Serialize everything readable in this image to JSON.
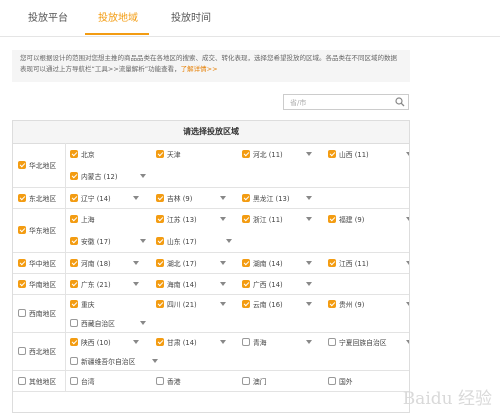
{
  "tabs": [
    "投放平台",
    "投放地域",
    "投放时间"
  ],
  "notice": {
    "text": "您可以根据设计的范围对您想主推的商品品类在各地区的搜索、成交、转化表现，选择您希望投放的区域。各品类在不同区域的数据表现可以通过上方导航栏“工具>>流量解析”功能查看，",
    "link": "了解详情>>"
  },
  "search": {
    "placeholder": "省/市"
  },
  "grid": {
    "header": "请选择投放区域"
  },
  "regions": [
    {
      "name": "华北地区",
      "checked": true,
      "provinces": [
        [
          "北京",
          true,
          false
        ],
        [
          "天津",
          true,
          false
        ],
        [
          "河北 (11)",
          true,
          true
        ],
        [
          "山西 (11)",
          true,
          true
        ],
        [
          "内蒙古 (12)",
          true,
          true
        ]
      ]
    },
    {
      "name": "东北地区",
      "checked": true,
      "provinces": [
        [
          "辽宁 (14)",
          true,
          true
        ],
        [
          "吉林 (9)",
          true,
          true
        ],
        [
          "黑龙江 (13)",
          true,
          true
        ]
      ]
    },
    {
      "name": "华东地区",
      "checked": true,
      "provinces": [
        [
          "上海",
          true,
          false
        ],
        [
          "江苏 (13)",
          true,
          true
        ],
        [
          "浙江 (11)",
          true,
          true
        ],
        [
          "福建 (9)",
          true,
          true
        ],
        [
          "安徽 (17)",
          true,
          true
        ],
        [
          "山东 (17)",
          true,
          true
        ]
      ]
    },
    {
      "name": "华中地区",
      "checked": true,
      "provinces": [
        [
          "河南 (18)",
          true,
          true
        ],
        [
          "湖北 (17)",
          true,
          true
        ],
        [
          "湖南 (14)",
          true,
          true
        ],
        [
          "江西 (11)",
          true,
          true
        ]
      ]
    },
    {
      "name": "华南地区",
      "checked": true,
      "provinces": [
        [
          "广东 (21)",
          true,
          true
        ],
        [
          "海南 (14)",
          true,
          true
        ],
        [
          "广西 (14)",
          true,
          true
        ]
      ]
    },
    {
      "name": "西南地区",
      "checked": false,
      "provinces": [
        [
          "重庆",
          true,
          false
        ],
        [
          "四川 (21)",
          true,
          true
        ],
        [
          "云南 (16)",
          true,
          true
        ],
        [
          "贵州 (9)",
          true,
          true
        ],
        [
          "西藏自治区",
          false,
          true
        ]
      ]
    },
    {
      "name": "西北地区",
      "checked": false,
      "provinces": [
        [
          "陕西 (10)",
          true,
          true
        ],
        [
          "甘肃 (14)",
          true,
          true
        ],
        [
          "青海",
          false,
          true
        ],
        [
          "宁夏回族自治区",
          false,
          true
        ],
        [
          "新疆维吾尔自治区",
          false,
          true
        ]
      ]
    },
    {
      "name": "其他地区",
      "checked": false,
      "provinces": [
        [
          "台湾",
          false,
          false
        ],
        [
          "香港",
          false,
          false
        ],
        [
          "澳门",
          false,
          false
        ],
        [
          "国外",
          false,
          false
        ]
      ]
    }
  ],
  "watermark": "Baidu 经验",
  "colors": {
    "accent": "#f39c12",
    "border": "#e3e3e3"
  }
}
